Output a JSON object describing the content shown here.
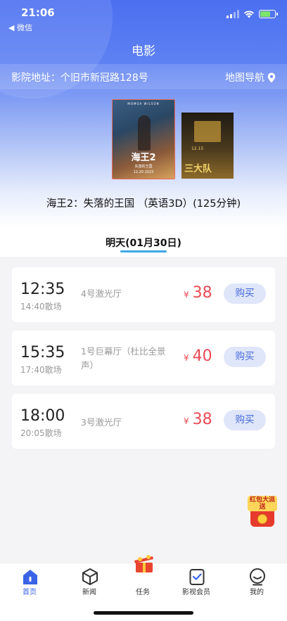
{
  "status_bar": {
    "time": "21:06",
    "back_label": "◀ 微信"
  },
  "header": {
    "title": "电影",
    "address": "影院地址：个旧市新冠路128号",
    "map_nav": "地图导航"
  },
  "posters": {
    "main": {
      "top_text": "MOMOA WILSON",
      "title": "海王2",
      "subtitle": "失落的王国",
      "date": "12.20 2023"
    },
    "side": {
      "date": "12.15",
      "title": "三大队"
    }
  },
  "movie": {
    "title": "海王2：失落的王国 （英语3D）(125分钟)"
  },
  "date_tabs": [
    {
      "label": "明天(01月30日)",
      "active": true
    }
  ],
  "showtimes": [
    {
      "start": "12:35",
      "end": "14:40散场",
      "hall": "4号激光厅",
      "currency": "¥",
      "price": "38",
      "button": "购买"
    },
    {
      "start": "15:35",
      "end": "17:40散场",
      "hall": "1号巨幕厅（杜比全景声）",
      "currency": "¥",
      "price": "40",
      "button": "购买"
    },
    {
      "start": "18:00",
      "end": "20:05散场",
      "hall": "3号激光厅",
      "currency": "¥",
      "price": "38",
      "button": "购买"
    }
  ],
  "floating_badge": {
    "text": "红包大派送"
  },
  "tab_bar": [
    {
      "label": "首页",
      "icon": "home-icon",
      "active": true
    },
    {
      "label": "新闻",
      "icon": "cube-icon",
      "active": false
    },
    {
      "label": "任务",
      "icon": "gift-box-icon",
      "active": false
    },
    {
      "label": "影视会员",
      "icon": "member-card-icon",
      "active": false
    },
    {
      "label": "我的",
      "icon": "profile-icon",
      "active": false
    }
  ],
  "colors": {
    "accent": "#3a63e6",
    "price": "#ec4a55",
    "button_bg": "#dfe6fa",
    "tab_underline": "#3fa8e6"
  }
}
